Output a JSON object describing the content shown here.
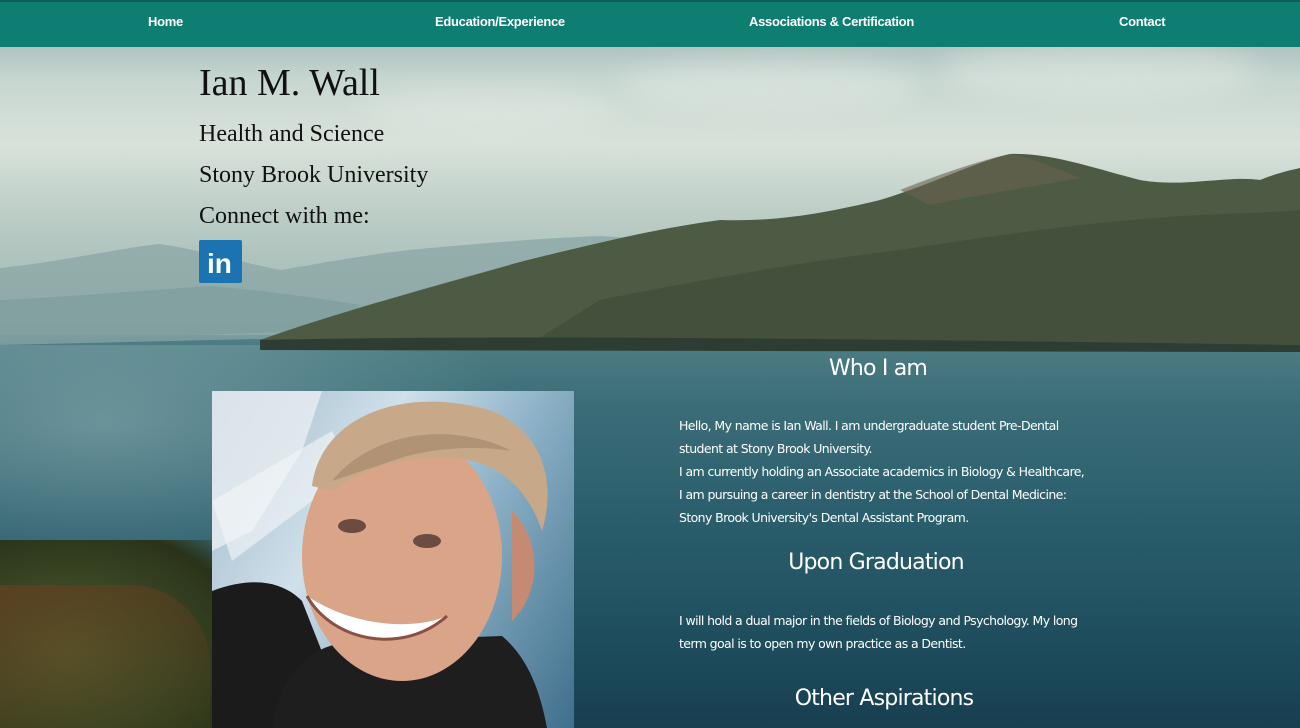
{
  "nav": {
    "items": [
      {
        "label": "Home"
      },
      {
        "label": "Education/Experience"
      },
      {
        "label": "Associations & Certification"
      },
      {
        "label": "Contact"
      }
    ]
  },
  "hero": {
    "name": "Ian M. Wall",
    "field": "Health and Science",
    "school": "Stony Brook University",
    "connect": "Connect with me:",
    "social_icon": "linkedin-icon",
    "social_text": "in"
  },
  "sections": {
    "who_title": "Who I am",
    "who_body_1": "Hello, My name is Ian Wall. I am undergraduate student Pre-Dental student at Stony Brook University.",
    "who_body_2": "I am currently holding an Associate academics in Biology & Healthcare, I am pursuing a career in dentistry at the School of Dental Medicine: Stony Brook University's Dental Assistant Program.",
    "grad_title": "Upon Graduation",
    "grad_body": "I will hold a dual major in the fields of Biology and Psychology. My long term goal is to open my own practice as a Dentist.",
    "other_title": "Other Aspirations"
  },
  "colors": {
    "nav_bg": "#0e7d72",
    "linkedin": "#1b73b2",
    "lake": "#2b5f6d"
  }
}
